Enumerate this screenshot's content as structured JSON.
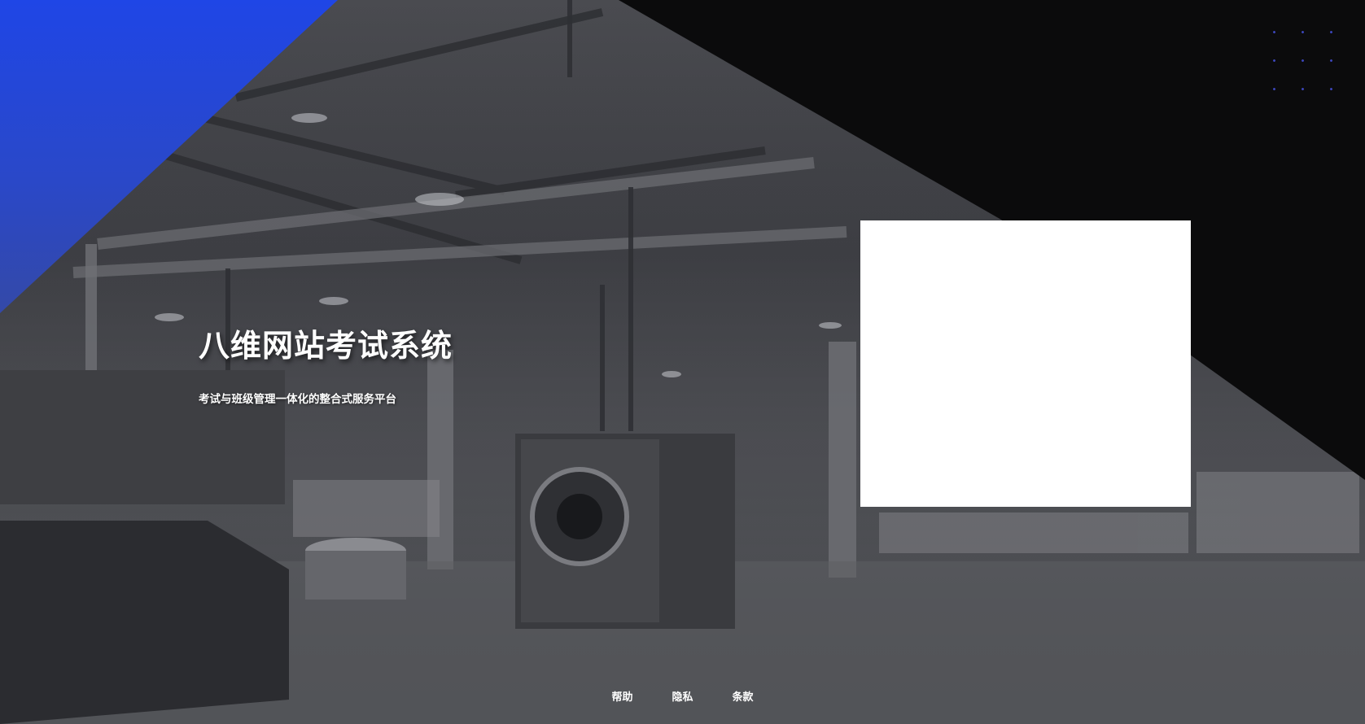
{
  "hero": {
    "title": "八维网站考试系统",
    "subtitle": "考试与班级管理一体化的整合式服务平台"
  },
  "footer": {
    "links": [
      {
        "label": "帮助"
      },
      {
        "label": "隐私"
      },
      {
        "label": "条款"
      }
    ]
  },
  "colors": {
    "accent": "#1f46e6",
    "card": "#ffffff",
    "dark_overlay": "#0b0b0c"
  }
}
